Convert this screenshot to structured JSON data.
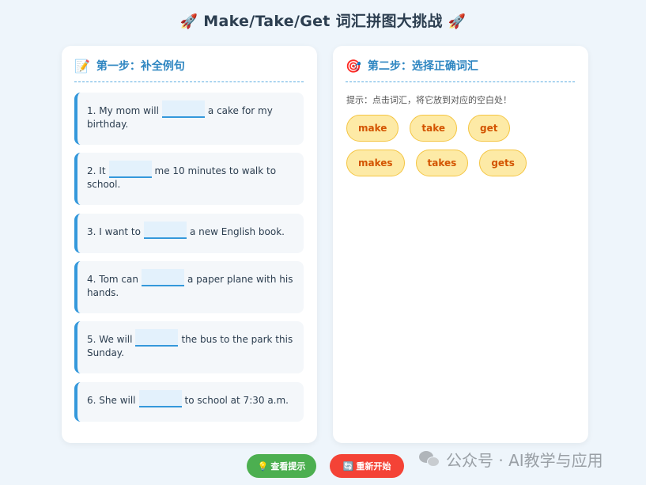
{
  "title": {
    "text": "Make/Take/Get 词汇拼图大挑战",
    "left_icon": "rocket-icon",
    "right_icon": "rocket-icon"
  },
  "left_panel": {
    "icon": "memo-icon",
    "heading": "第一步：补全例句",
    "sentences": [
      {
        "num": "1.",
        "before": "My mom will",
        "after": "a cake for my birthday."
      },
      {
        "num": "2.",
        "before": "It",
        "after": "me 10 minutes to walk to school."
      },
      {
        "num": "3.",
        "before": "I want to",
        "after": "a new English book."
      },
      {
        "num": "4.",
        "before": "Tom can",
        "after": "a paper plane with his hands."
      },
      {
        "num": "5.",
        "before": "We will",
        "after": "the bus to the park this Sunday."
      },
      {
        "num": "6.",
        "before": "She will",
        "after": "to school at 7:30 a.m."
      }
    ]
  },
  "right_panel": {
    "icon": "target-icon",
    "heading": "第二步：选择正确词汇",
    "hint": "提示：点击词汇，将它放到对应的空白处！",
    "words": [
      "make",
      "take",
      "get",
      "makes",
      "takes",
      "gets"
    ]
  },
  "buttons": {
    "hint_icon": "lightbulb-icon",
    "hint_label": "查看提示",
    "reset_icon": "refresh-icon",
    "reset_label": "重新开始"
  },
  "watermark": {
    "text": "公众号 · AI教学与应用"
  },
  "colors": {
    "accent": "#3498db",
    "heading": "#2e86c1",
    "chip_bg": "#fdeaa6",
    "chip_text": "#d35400",
    "hint_button": "#4caf50",
    "reset_button": "#f44336"
  }
}
